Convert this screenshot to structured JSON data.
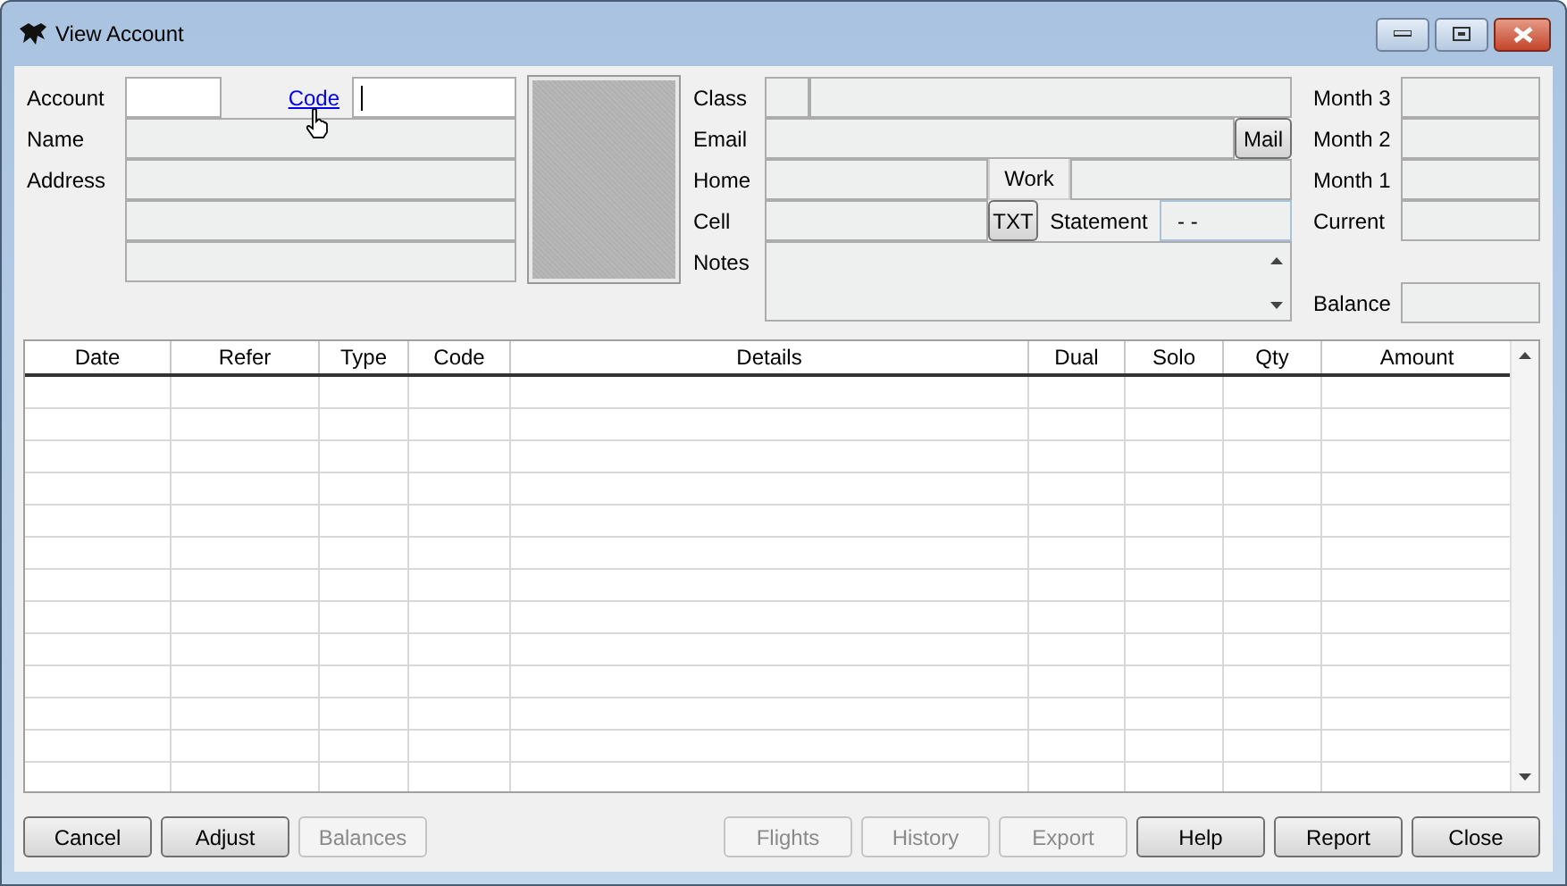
{
  "window": {
    "title": "View Account"
  },
  "account": {
    "label": "Account",
    "code_link": "Code",
    "code_focused": true
  },
  "labels_left": [
    "Name",
    "Address"
  ],
  "labels_mid": [
    "Class",
    "Email",
    "Home",
    "Cell",
    "Notes"
  ],
  "work_label": "Work",
  "mail_button": "Mail",
  "txt_button": "TXT",
  "statement": {
    "label": "Statement",
    "value": "- -"
  },
  "labels_right": [
    "Month 3",
    "Month 2",
    "Month 1",
    "Current"
  ],
  "balance_label": "Balance",
  "table": {
    "columns": [
      "Date",
      "Refer",
      "Type",
      "Code",
      "Details",
      "Dual",
      "Solo",
      "Qty",
      "Amount"
    ]
  },
  "buttons_left": [
    {
      "label": "Cancel",
      "disabled": false
    },
    {
      "label": "Adjust",
      "disabled": false
    },
    {
      "label": "Balances",
      "disabled": true
    }
  ],
  "buttons_right": [
    {
      "label": "Flights",
      "disabled": true
    },
    {
      "label": "History",
      "disabled": true
    },
    {
      "label": "Export",
      "disabled": true
    },
    {
      "label": "Help",
      "disabled": false
    },
    {
      "label": "Report",
      "disabled": false
    },
    {
      "label": "Close",
      "disabled": false
    }
  ]
}
